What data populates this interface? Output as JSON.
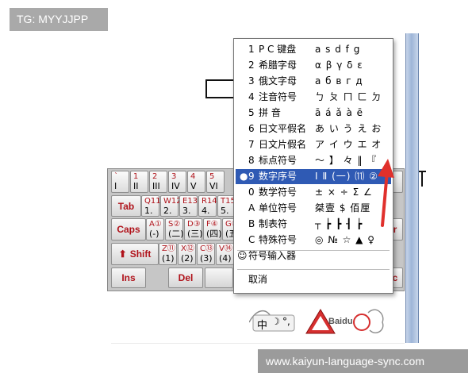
{
  "badge": "TG: MYYJJPP",
  "watermark": "www.kaiyun-language-sync.com",
  "keyboard": {
    "row1": [
      {
        "top": "`",
        "bot": "I"
      },
      {
        "top": "1",
        "bot": "II"
      },
      {
        "top": "2",
        "bot": "III"
      },
      {
        "top": "3",
        "bot": "IV"
      },
      {
        "top": "4",
        "bot": "V"
      },
      {
        "top": "5",
        "bot": "VI"
      }
    ],
    "row2": [
      {
        "top": "Q11.",
        "bot": "1."
      },
      {
        "top": "W12.",
        "bot": "2."
      },
      {
        "top": "E13.",
        "bot": "3."
      },
      {
        "top": "R14.",
        "bot": "4."
      },
      {
        "top": "T15.",
        "bot": "5."
      }
    ],
    "row3": [
      {
        "top": "A①",
        "bot": "(-)"
      },
      {
        "top": "S②",
        "bot": "(二)"
      },
      {
        "top": "D③",
        "bot": "(三)"
      },
      {
        "top": "F④",
        "bot": "(四)"
      },
      {
        "top": "G⑤",
        "bot": "(五)"
      }
    ],
    "row4": [
      {
        "top": "Z⑪",
        "bot": "(1)"
      },
      {
        "top": "X⑫",
        "bot": "(2)"
      },
      {
        "top": "C⑬",
        "bot": "(3)"
      },
      {
        "top": "V⑭",
        "bot": "(4)"
      }
    ],
    "tab": "Tab",
    "caps": "Caps",
    "shift": "Shift",
    "ins": "Ins",
    "del": "Del",
    "right_edge_1": "r",
    "right_edge_2": "c"
  },
  "menu": {
    "items": [
      {
        "num": "1",
        "label": "P C 键盘",
        "sample": "a s d f g"
      },
      {
        "num": "2",
        "label": "希腊字母",
        "sample": "α β γ δ ε"
      },
      {
        "num": "3",
        "label": "俄文字母",
        "sample": "а б в г д"
      },
      {
        "num": "4",
        "label": "注音符号",
        "sample": "ㄅ ㄆ ㄇ ㄈ ㄉ"
      },
      {
        "num": "5",
        "label": "拼    音",
        "sample": "ā á ǎ à ē"
      },
      {
        "num": "6",
        "label": "日文平假名",
        "sample": "あ い う え お"
      },
      {
        "num": "7",
        "label": "日文片假名",
        "sample": "ア イ ウ エ オ"
      },
      {
        "num": "8",
        "label": "标点符号",
        "sample": "〜 】 々 ‖ 『"
      },
      {
        "num": "9",
        "label": "数字序号",
        "sample": "Ⅰ Ⅱ (一) ⑾ ②"
      },
      {
        "num": "0",
        "label": "数学符号",
        "sample": "± × ÷ Σ ∠"
      },
      {
        "num": "A",
        "label": "单位符号",
        "sample": "桀壹 $ 佰厘"
      },
      {
        "num": "B",
        "label": "制表符",
        "sample": "┬ ┢ ┣ ┨ ┢"
      },
      {
        "num": "C",
        "label": "特殊符号",
        "sample": "◎ № ☆ ▲ ♀"
      }
    ],
    "selected_index": 8,
    "symbol_input": "符号输入器",
    "cancel": "取消"
  },
  "ime": {
    "lang": "中",
    "brand": "Baidu"
  },
  "colors": {
    "menu_highlight": "#2f5ab4",
    "key_accent": "#b0131b",
    "arrow": "#e0302c"
  }
}
